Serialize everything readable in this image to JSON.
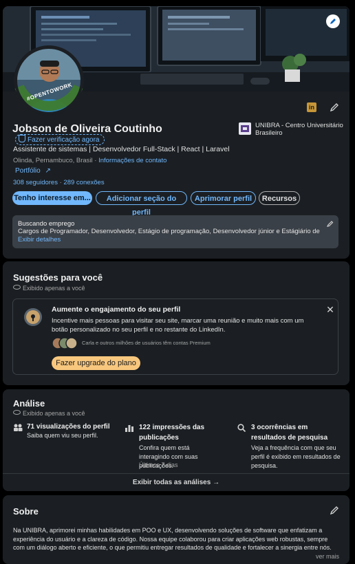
{
  "profile": {
    "name": "Jobson de Oliveira Coutinho",
    "verify_label": "Fazer verificação agora",
    "headline": "Assistente de sistemas | Desenvolvedor Full-Stack | React | Laravel",
    "location": "Olinda, Pernambuco, Brasil",
    "location_sep": " · ",
    "contact_link": "Informações de contato",
    "portfolio_link": "Portfólio",
    "followers": "308 seguidores",
    "connections_sep": " · ",
    "connections": "289 conexões",
    "education": "UNIBRA - Centro Universitário Brasileiro",
    "open_to_work_badge": "#OPENTOWORK",
    "buttons": {
      "open_to": "Tenho interesse em...",
      "add_section": "Adicionar seção do perfil",
      "enhance": "Aprimorar perfil",
      "resources": "Recursos"
    },
    "job_search": {
      "title": "Buscando emprego",
      "text": "Cargos de Programador, Desenvolvedor, Estágio de programação, Desenvolvedor júnior e Estágiário de engenha...",
      "details_link": "Exibir detalhes"
    }
  },
  "suggestions": {
    "title": "Sugestões para você",
    "visibility": "Exibido apenas a você",
    "promo": {
      "title": "Aumente o engajamento do seu perfil",
      "text": "Incentive mais pessoas para visitar seu site, marcar uma reunião e muito mais com um botão personalizado no seu perfil e no restante do LinkedIn.",
      "social_proof": "Carla e outros milhões de usuários têm contas Premium",
      "cta": "Fazer upgrade do plano"
    }
  },
  "analytics": {
    "title": "Análise",
    "visibility": "Exibido apenas a você",
    "items": [
      {
        "title": "71 visualizações do perfil",
        "desc": "Saiba quem viu seu perfil.",
        "extra": ""
      },
      {
        "title": "122 impressões das publicações",
        "desc": "Confira quem está interagindo com suas publicações.",
        "extra": "Últimos 7 dias"
      },
      {
        "title": "3 ocorrências em resultados de pesquisa",
        "desc": "Veja a frequência com que seu perfil é exibido em resultados de pesquisa.",
        "extra": ""
      }
    ],
    "show_all": "Exibir todas as análises →"
  },
  "about": {
    "title": "Sobre",
    "text": "Na UNIBRA, aprimorei minhas habilidades em POO e UX, desenvolvendo soluções de software que enfatizam a experiência do usuário e a clareza de código. Nossa equipe colaborou para criar aplicações web robustas, sempre com um diálogo aberto e eficiente, o que permitiu entregar resultados de qualidade e fortalecer a sinergia entre nós.",
    "see_more": "ver mais"
  },
  "colors": {
    "background": "#000000",
    "card": "#1b1f23",
    "link": "#71b7fb",
    "premium_gold": "#f8c77e",
    "open_to_work_green": "#3e7b2f"
  }
}
